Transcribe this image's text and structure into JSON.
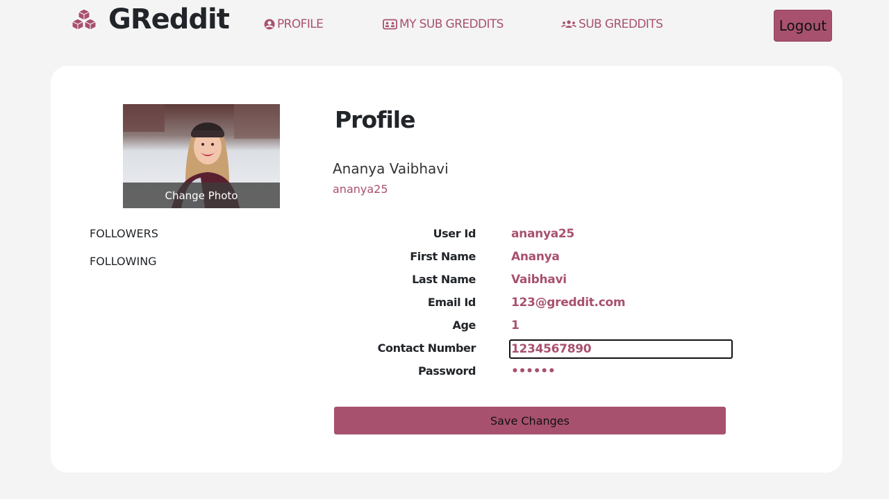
{
  "brand": {
    "name": "GReddit",
    "icon": "cubes-icon"
  },
  "nav": {
    "profile": {
      "label": "PROFILE",
      "icon": "user-circle-icon"
    },
    "my_subgreddits": {
      "label": "MY SUB GREDDITS",
      "icon": "id-card-icon"
    },
    "subgreddits": {
      "label": "SUB GREDDITS",
      "icon": "users-icon"
    },
    "logout": "Logout"
  },
  "profile": {
    "heading": "Profile",
    "full_name": "Ananya Vaibhavi",
    "username": "ananya25",
    "change_photo": "Change Photo",
    "followers_label": "FOLLOWERS",
    "following_label": "FOLLOWING"
  },
  "fields": {
    "user_id": {
      "label": "User Id",
      "value": "ananya25"
    },
    "first_name": {
      "label": "First Name",
      "value": "Ananya"
    },
    "last_name": {
      "label": "Last Name",
      "value": "Vaibhavi"
    },
    "email": {
      "label": "Email Id",
      "value": "123@greddit.com"
    },
    "age": {
      "label": "Age",
      "value": "1"
    },
    "contact": {
      "label": "Contact Number",
      "value": "1234567890"
    },
    "password": {
      "label": "Password",
      "value": "••••••"
    }
  },
  "save_label": "Save Changes",
  "colors": {
    "accent": "#a8516e",
    "background": "#f4f4f4",
    "card": "#ffffff"
  }
}
